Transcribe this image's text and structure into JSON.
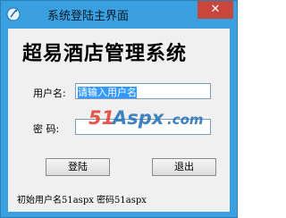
{
  "window": {
    "title": "系统登陆主界面",
    "close_glyph": "✕"
  },
  "main": {
    "headline": "超易酒店管理系统",
    "username_label": "用户名:",
    "username_value": "请输入用户名",
    "password_label": "密    码:",
    "password_value": "",
    "login_button": "登陆",
    "exit_button": "退出",
    "hint": "初始用户名51aspx  密码51aspx"
  },
  "watermark": {
    "text": "51Aspx.com",
    "brand": "51",
    "suffix": "Aspx",
    "domain": ".com"
  },
  "colors": {
    "frame": "#3aa0e0",
    "close": "#c9463d",
    "selection": "#3399ff",
    "watermark_red": "#e23b2e",
    "watermark_blue": "#1f6fb8"
  },
  "icons": {
    "app": "app-icon",
    "close": "close-icon"
  }
}
